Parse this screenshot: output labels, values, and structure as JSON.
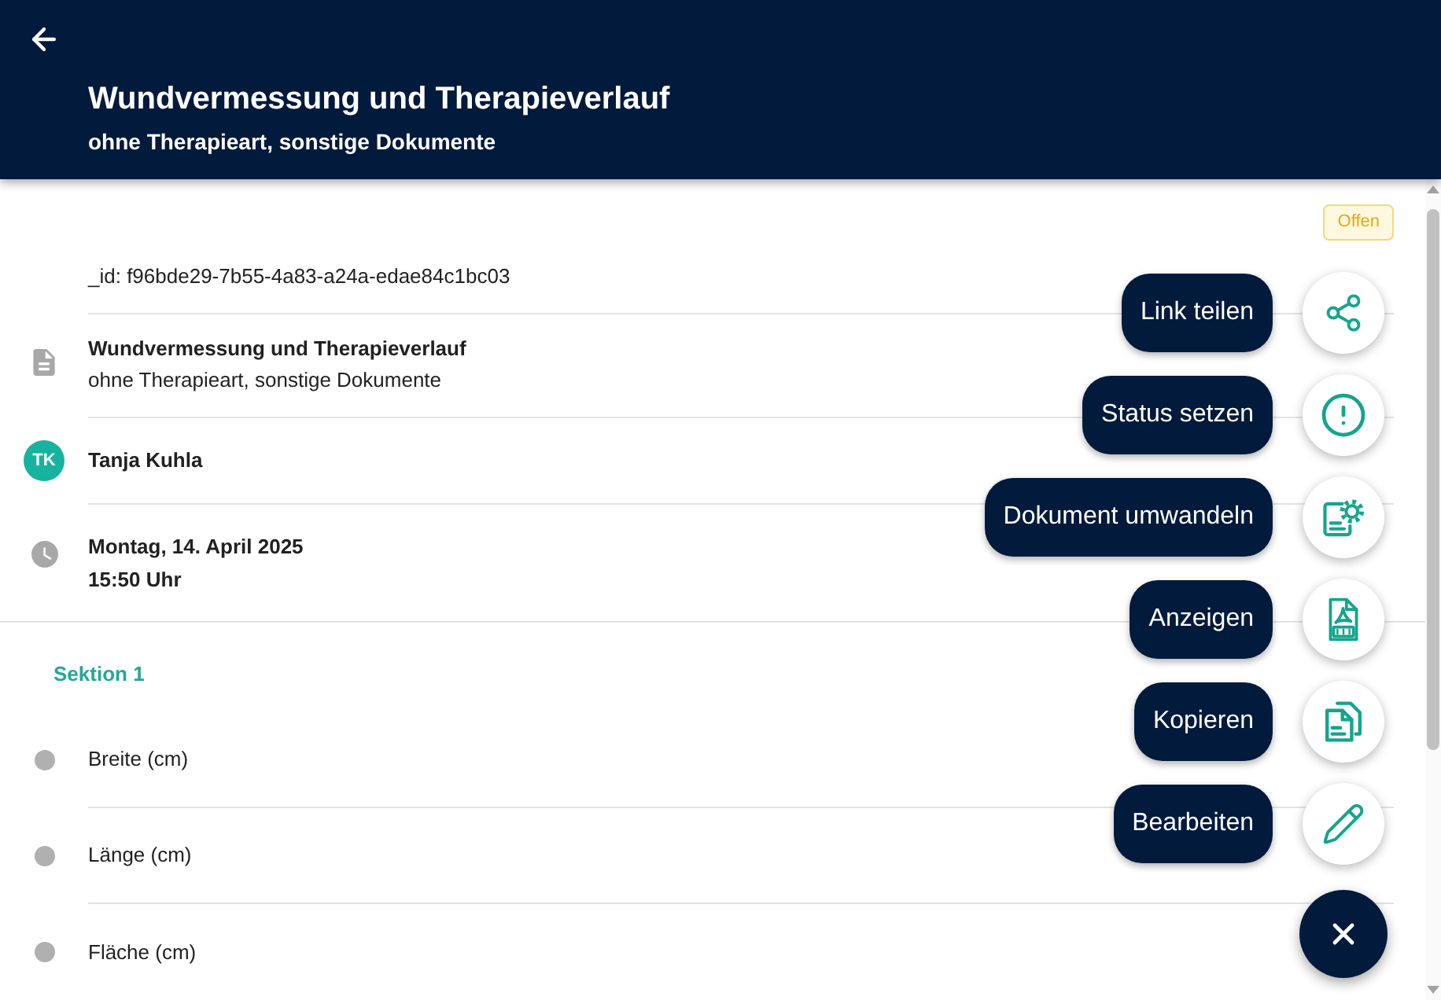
{
  "header": {
    "title": "Wundvermessung und Therapieverlauf",
    "subtitle": "ohne Therapieart, sonstige Dokumente"
  },
  "status_badge": {
    "label": "Offen"
  },
  "details": [
    {
      "kind": "id",
      "text": "_id: f96bde29-7b55-4a83-a24a-edae84c1bc03"
    },
    {
      "kind": "document",
      "title": "Wundvermessung und Therapieverlauf",
      "subtitle": "ohne Therapieart, sonstige Dokumente"
    },
    {
      "kind": "person",
      "initials": "TK",
      "name": "Tanja Kuhla"
    },
    {
      "kind": "datetime",
      "date": "Montag, 14. April 2025",
      "time": "15:50 Uhr"
    }
  ],
  "sections": [
    {
      "title": "Sektion 1",
      "fields": [
        {
          "label": "Breite (cm)"
        },
        {
          "label": "Länge (cm)"
        },
        {
          "label": "Fläche (cm)"
        }
      ]
    }
  ],
  "speed_dial": {
    "expanded": true,
    "actions": [
      {
        "kind": "share",
        "label": "Link teilen"
      },
      {
        "kind": "status",
        "label": "Status setzen"
      },
      {
        "kind": "convert",
        "label": "Dokument umwandeln"
      },
      {
        "kind": "pdf",
        "label": "Anzeigen"
      },
      {
        "kind": "copy",
        "label": "Kopieren"
      },
      {
        "kind": "edit",
        "label": "Bearbeiten"
      }
    ]
  }
}
